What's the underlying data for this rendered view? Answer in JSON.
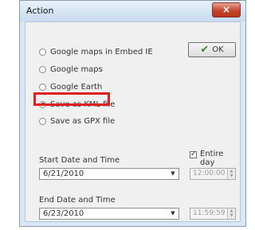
{
  "window": {
    "title": "Action",
    "close_glyph": "×"
  },
  "options": [
    {
      "label": "Google maps in Embed IE",
      "selected": false
    },
    {
      "label": "Google maps",
      "selected": false
    },
    {
      "label": "Google Earth",
      "selected": false
    },
    {
      "label": "Save as KML file",
      "selected": true
    },
    {
      "label": "Save as GPX file",
      "selected": false
    }
  ],
  "ok_button": {
    "label": "OK",
    "icon": "check-icon"
  },
  "entire_day": {
    "label": "Entire day",
    "checked": true
  },
  "start": {
    "label": "Start Date and Time",
    "date": "6/21/2010",
    "time": "12:00:00 AM"
  },
  "end": {
    "label": "End Date and Time",
    "date": "6/23/2010",
    "time": "11:59:59 PM"
  },
  "colors": {
    "highlight": "#e02020",
    "check": "#3b8a2e",
    "close": "#c4452b"
  }
}
